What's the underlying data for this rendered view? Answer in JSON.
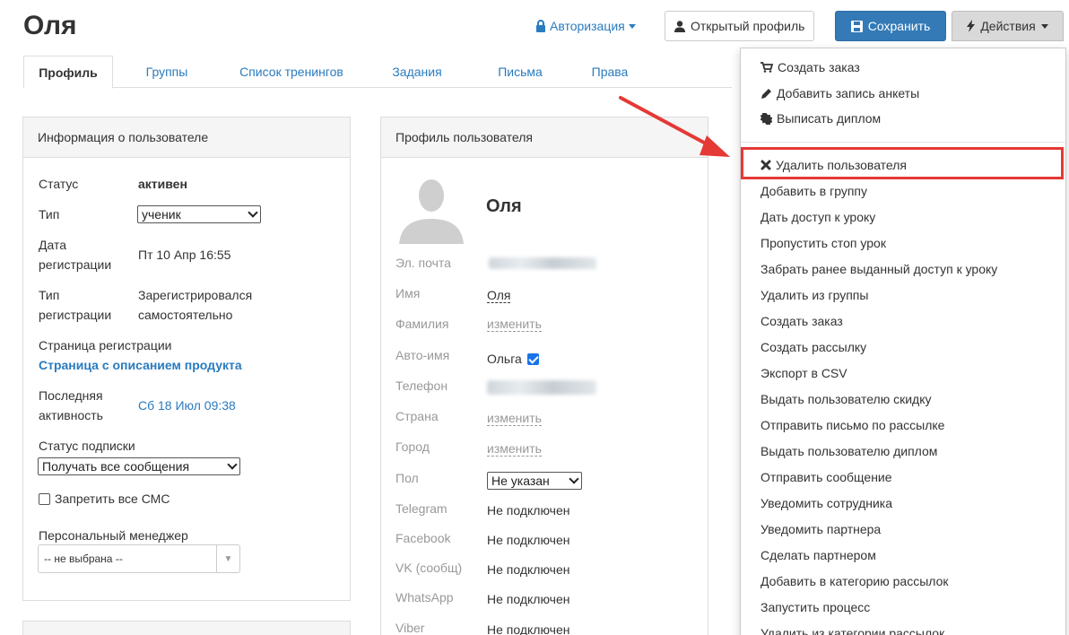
{
  "page": {
    "title": "Оля"
  },
  "header": {
    "auth_label": "Авторизация",
    "open_profile_label": "Открытый профиль",
    "save_label": "Сохранить",
    "actions_label": "Действия"
  },
  "tabs": [
    {
      "label": "Профиль",
      "active": true
    },
    {
      "label": "Группы"
    },
    {
      "label": "Список тренингов"
    },
    {
      "label": "Задания"
    },
    {
      "label": "Письма"
    },
    {
      "label": "Права"
    }
  ],
  "user_info": {
    "heading": "Информация о пользователе",
    "status_label": "Статус",
    "status_value": "активен",
    "type_label": "Тип",
    "type_value": "ученик",
    "reg_date_label_1": "Дата",
    "reg_date_label_2": "регистрации",
    "reg_date_value": "Пт 10 Апр 16:55",
    "reg_type_label_1": "Тип",
    "reg_type_label_2": "регистрации",
    "reg_type_value_1": "Зарегистрировался",
    "reg_type_value_2": "самостоятельно",
    "reg_page_label": "Страница регистрации",
    "reg_page_value": "Страница с описанием продукта",
    "last_activity_label_1": "Последняя",
    "last_activity_label_2": "активность",
    "last_activity_value": "Сб 18 Июл 09:38",
    "subscription_label": "Статус подписки",
    "subscription_value": "Получать все сообщения",
    "block_sms_label": "Запретить все СМС",
    "manager_label": "Персональный менеджер",
    "manager_value": "-- не выбрана --"
  },
  "profile": {
    "heading": "Профиль пользователя",
    "name": "Оля",
    "email_label": "Эл. почта",
    "first_name_label": "Имя",
    "first_name_value": "Оля",
    "last_name_label": "Фамилия",
    "change_label": "изменить",
    "autoname_label": "Авто-имя",
    "autoname_value": "Ольга",
    "phone_label": "Телефон",
    "country_label": "Страна",
    "city_label": "Город",
    "gender_label": "Пол",
    "gender_value": "Не указан",
    "telegram_label": "Telegram",
    "facebook_label": "Facebook",
    "vk_label": "VK (сообщ)",
    "whatsapp_label": "WhatsApp",
    "viber_label": "Viber",
    "not_connected": "Не подключен"
  },
  "actions_menu": {
    "top": [
      "Создать заказ",
      "Добавить запись анкеты",
      "Выписать диплом"
    ],
    "delete_user": "Удалить пользователя",
    "items": [
      "Добавить в группу",
      "Дать доступ к уроку",
      "Пропустить стоп урок",
      "Забрать ранее выданный доступ к уроку",
      "Удалить из группы",
      "Создать заказ",
      "Создать рассылку",
      "Экспорт в CSV",
      "Выдать пользователю скидку",
      "Отправить письмо по рассылке",
      "Выдать пользователю диплом",
      "Отправить сообщение",
      "Уведомить сотрудника",
      "Уведомить партнера",
      "Сделать партнером",
      "Добавить в категорию рассылок",
      "Запустить процесс",
      "Удалить из категории рассылок"
    ]
  },
  "colors": {
    "accent": "#2a7bbf",
    "primary_button": "#337ab7",
    "highlight": "#e53935"
  }
}
